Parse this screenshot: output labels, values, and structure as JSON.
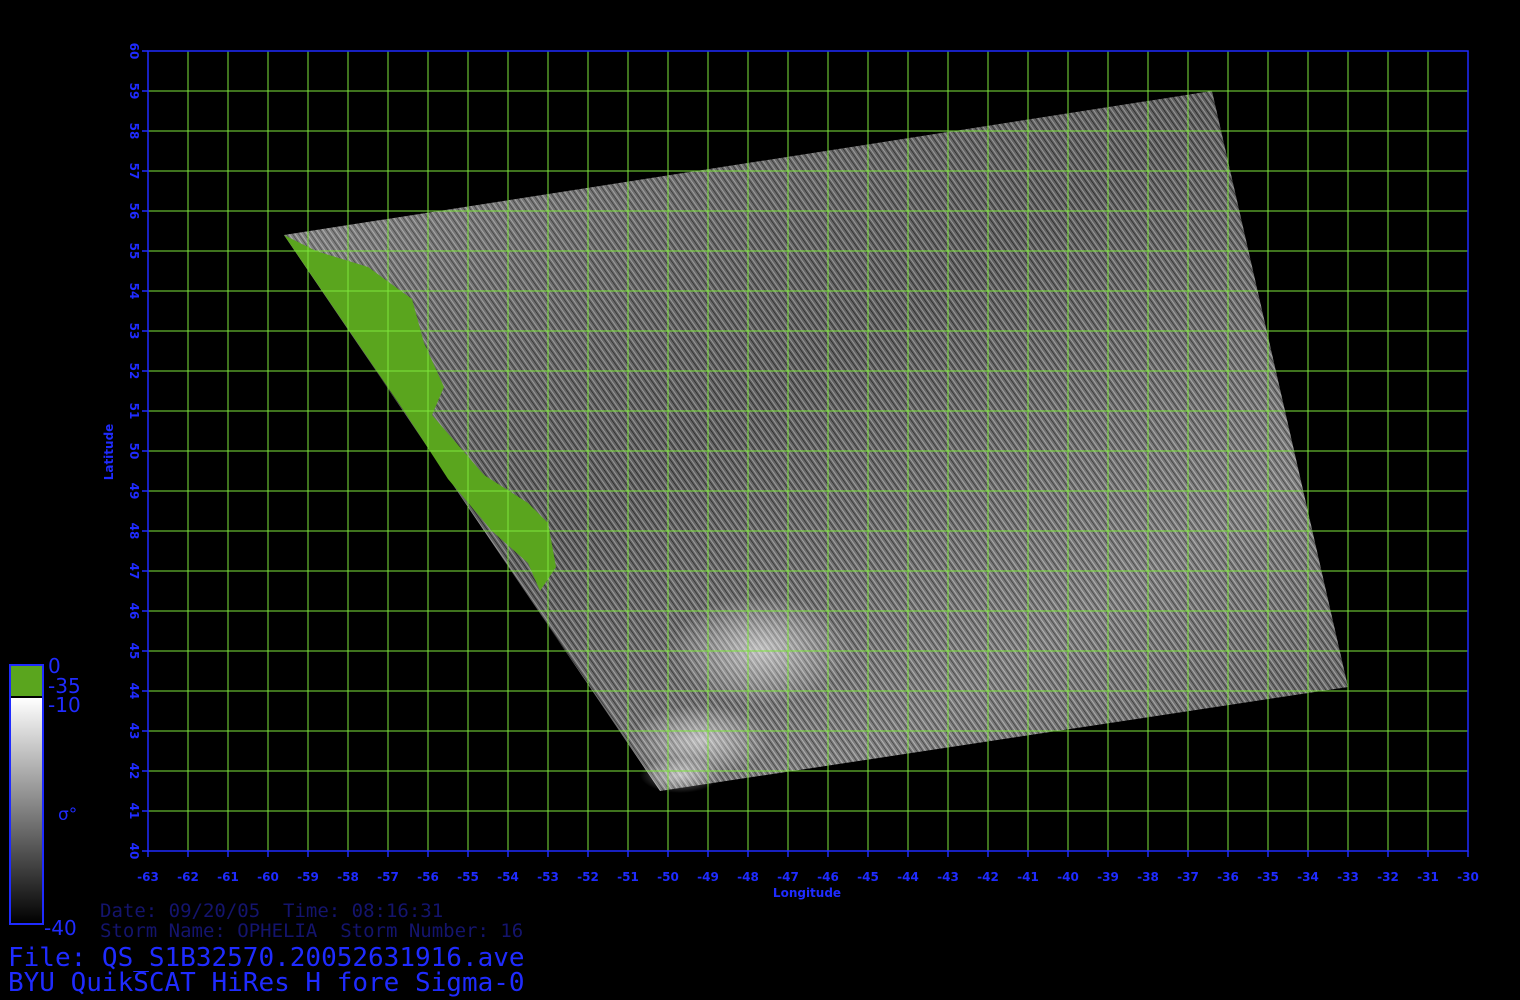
{
  "colors": {
    "background": "#000000",
    "axis": "#1f2bff",
    "grid": "#7ee63c",
    "land": "#5aa51e",
    "info_dim": "#14146e"
  },
  "map": {
    "lon_range": [
      -63,
      -30
    ],
    "lat_range": [
      40,
      60
    ],
    "lon_ticks": [
      "-63",
      "-62",
      "-61",
      "-60",
      "-59",
      "-58",
      "-57",
      "-56",
      "-55",
      "-54",
      "-53",
      "-52",
      "-51",
      "-50",
      "-49",
      "-48",
      "-47",
      "-46",
      "-45",
      "-44",
      "-43",
      "-42",
      "-41",
      "-40",
      "-39",
      "-38",
      "-37",
      "-36",
      "-35",
      "-34",
      "-33",
      "-32",
      "-31",
      "-30"
    ],
    "lat_ticks": [
      "40",
      "41",
      "42",
      "43",
      "44",
      "45",
      "46",
      "47",
      "48",
      "49",
      "50",
      "51",
      "52",
      "53",
      "54",
      "55",
      "56",
      "57",
      "58",
      "59",
      "60"
    ],
    "xlabel": "Longitude",
    "ylabel": "Latitude",
    "swath_corners": [
      [
        -59.6,
        55.4
      ],
      [
        -36.4,
        59.0
      ],
      [
        -33.0,
        44.1
      ],
      [
        -50.2,
        41.5
      ]
    ],
    "land_polygon": [
      [
        -59.6,
        55.4
      ],
      [
        -58.8,
        55.0
      ],
      [
        -57.5,
        54.6
      ],
      [
        -56.4,
        53.8
      ],
      [
        -56.1,
        52.7
      ],
      [
        -55.6,
        51.6
      ],
      [
        -55.9,
        50.9
      ],
      [
        -54.6,
        49.4
      ],
      [
        -53.5,
        48.7
      ],
      [
        -53.0,
        48.2
      ],
      [
        -52.8,
        47.1
      ],
      [
        -53.2,
        46.5
      ],
      [
        -53.5,
        47.2
      ],
      [
        -54.4,
        48.0
      ],
      [
        -55.5,
        49.3
      ],
      [
        -56.6,
        51.0
      ],
      [
        -58.1,
        53.2
      ]
    ]
  },
  "scale": {
    "top_label": "0",
    "land_label": "-35",
    "upper_label": "-10",
    "symbol": "σ°",
    "bottom_label": "-40"
  },
  "info": {
    "date_time": "Date: 09/20/05  Time: 08:16:31",
    "storm": "Storm Name: OPHELIA  Storm Number: 16",
    "file": "File: QS_S1B32570.20052631916.ave",
    "product": "BYU QuikSCAT HiRes H fore Sigma-0"
  }
}
